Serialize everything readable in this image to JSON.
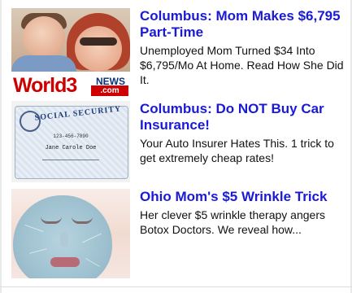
{
  "ads": [
    {
      "headline": "Columbus: Mom Makes $6,795 Part-Time",
      "description": "Unemployed Mom Turned $34 Into $6,795/Mo At Home. Read How She Did It.",
      "thumb": {
        "brand_main": "World3",
        "brand_news": "NEWS",
        "brand_suffix": ".com"
      }
    },
    {
      "headline": "Columbus: Do NOT Buy Car Insurance!",
      "description": "Your Auto Insurer Hates This. 1 trick to get extremely cheap rates!",
      "thumb": {
        "card_title": "SOCIAL SECURITY",
        "card_number": "123-456-7890",
        "card_name": "Jane Carole Doe"
      }
    },
    {
      "headline": "Ohio Mom's $5 Wrinkle Trick",
      "description": "Her clever $5 wrinkle therapy angers Botox Doctors. We reveal how...",
      "thumb": {}
    }
  ],
  "colors": {
    "headline": "#1a1ad6",
    "text": "#111111",
    "brand_red": "#cc0000",
    "brand_navy": "#0b2f76"
  }
}
